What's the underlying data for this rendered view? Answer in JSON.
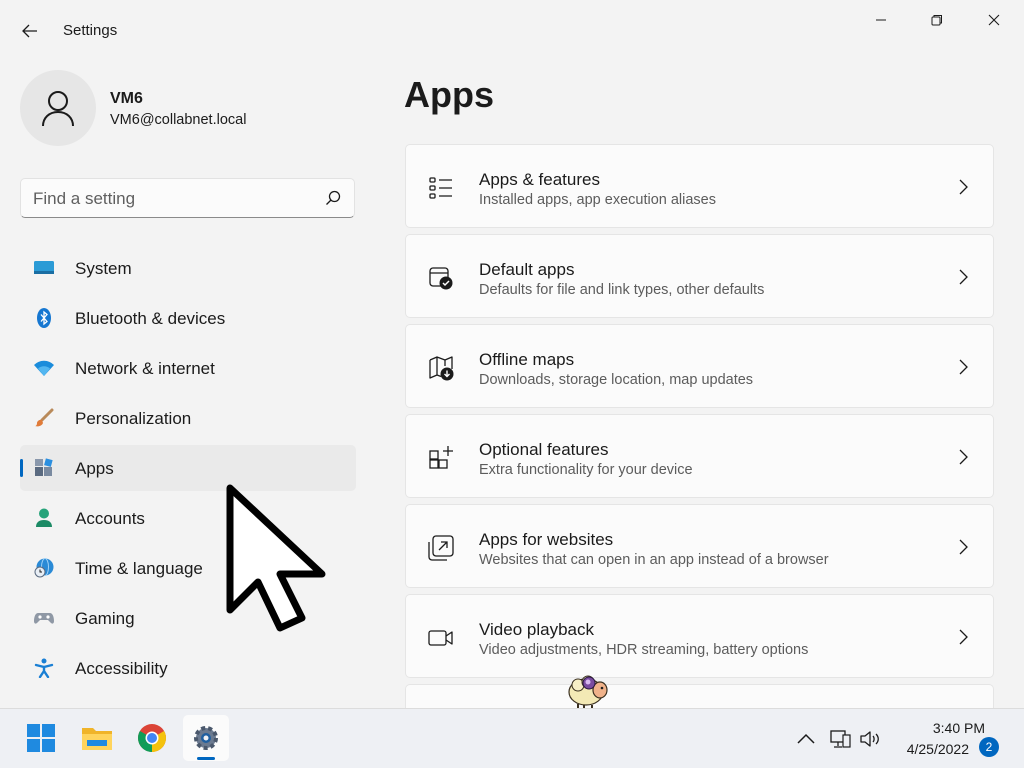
{
  "window": {
    "title": "Settings"
  },
  "profile": {
    "name": "VM6",
    "email": "VM6@collabnet.local"
  },
  "search": {
    "placeholder": "Find a setting"
  },
  "sidebar": {
    "items": [
      {
        "label": "System",
        "icon": "system-icon",
        "active": false
      },
      {
        "label": "Bluetooth & devices",
        "icon": "bluetooth-icon",
        "active": false
      },
      {
        "label": "Network & internet",
        "icon": "wifi-icon",
        "active": false
      },
      {
        "label": "Personalization",
        "icon": "brush-icon",
        "active": false
      },
      {
        "label": "Apps",
        "icon": "apps-icon",
        "active": true
      },
      {
        "label": "Accounts",
        "icon": "person-icon",
        "active": false
      },
      {
        "label": "Time & language",
        "icon": "globe-clock-icon",
        "active": false
      },
      {
        "label": "Gaming",
        "icon": "gamepad-icon",
        "active": false
      },
      {
        "label": "Accessibility",
        "icon": "accessibility-icon",
        "active": false
      }
    ]
  },
  "main": {
    "title": "Apps",
    "cards": [
      {
        "title": "Apps & features",
        "subtitle": "Installed apps, app execution aliases",
        "icon": "list-icon"
      },
      {
        "title": "Default apps",
        "subtitle": "Defaults for file and link types, other defaults",
        "icon": "default-apps-icon"
      },
      {
        "title": "Offline maps",
        "subtitle": "Downloads, storage location, map updates",
        "icon": "map-download-icon"
      },
      {
        "title": "Optional features",
        "subtitle": "Extra functionality for your device",
        "icon": "grid-add-icon"
      },
      {
        "title": "Apps for websites",
        "subtitle": "Websites that can open in an app instead of a browser",
        "icon": "open-external-icon"
      },
      {
        "title": "Video playback",
        "subtitle": "Video adjustments, HDR streaming, battery options",
        "icon": "video-icon"
      }
    ]
  },
  "taskbar": {
    "apps": [
      "windows-start-icon",
      "file-explorer-icon",
      "chrome-icon",
      "settings-gear-icon"
    ],
    "time": "3:40 PM",
    "date": "4/25/2022",
    "notifications": "2"
  },
  "colors": {
    "accent": "#0067c0",
    "background": "#f3f3f3",
    "card": "#fbfbfb"
  }
}
